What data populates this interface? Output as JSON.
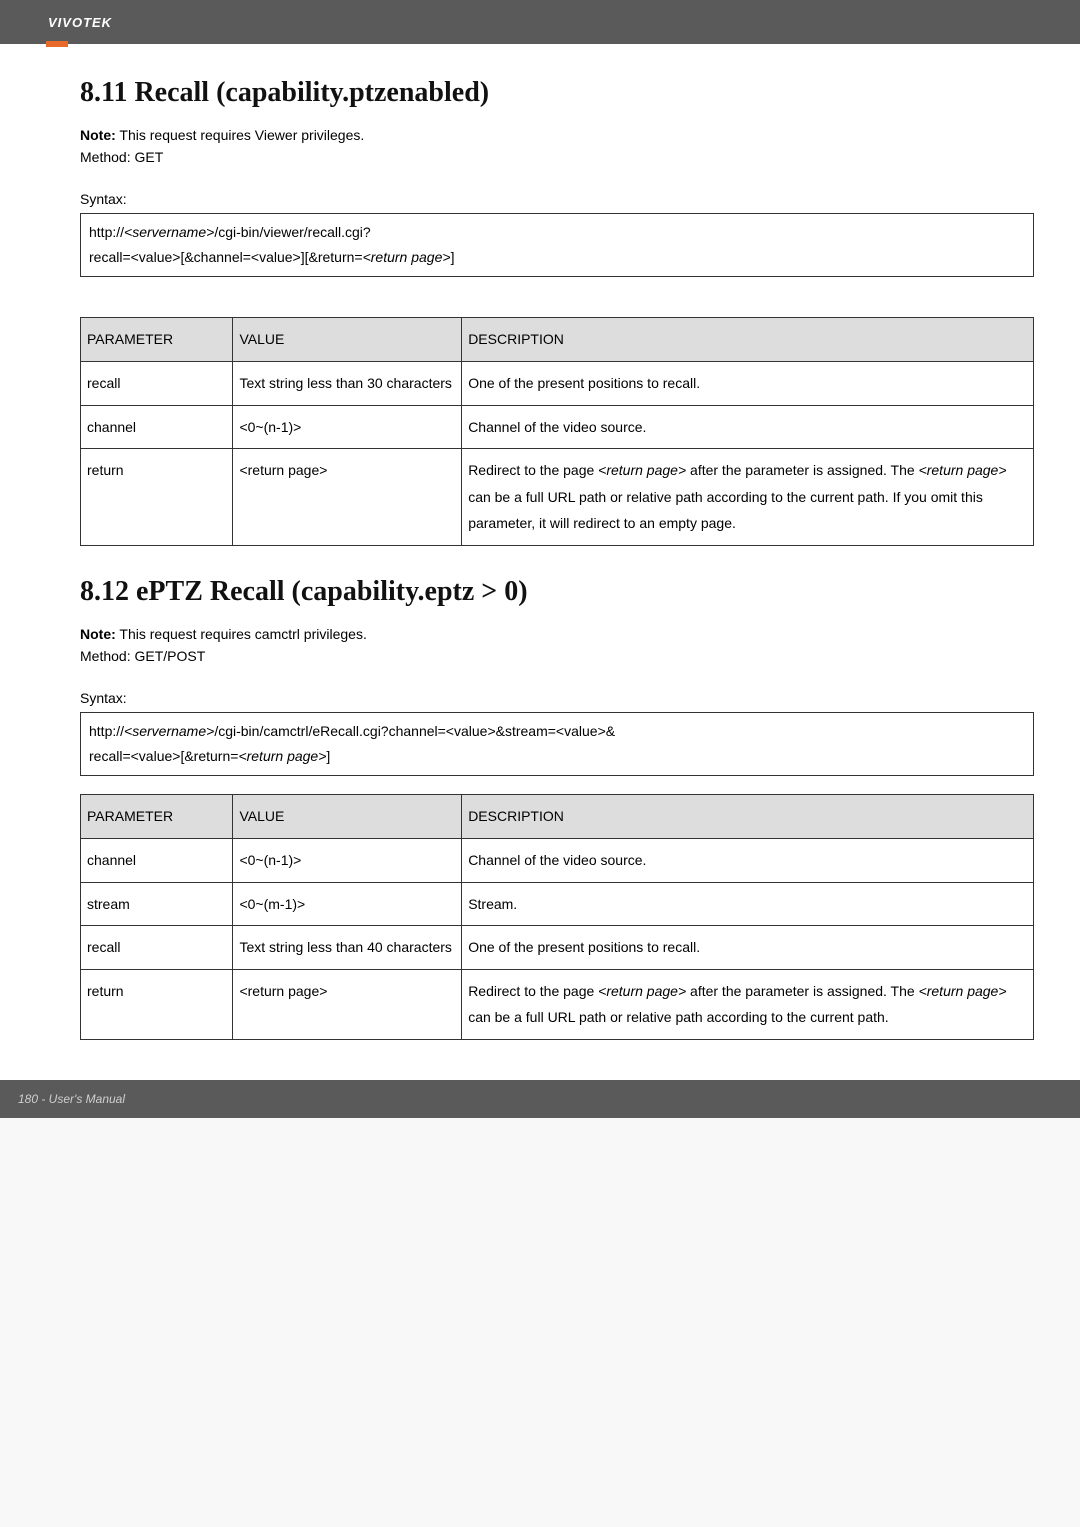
{
  "header": {
    "brand": "VIVOTEK"
  },
  "section1": {
    "title": "8.11 Recall (capability.ptzenabled)",
    "note_bold": "Note:",
    "note_text": " This request requires Viewer privileges.",
    "method": "Method: GET",
    "syntax_label": "Syntax:",
    "syntax_line1_pre": "http://",
    "syntax_line1_srv": "<servername>",
    "syntax_line1_post": "/cgi-bin/viewer/recall.cgi?",
    "syntax_line2_pre": "recall=<value>[&channel=<value>][&return=",
    "syntax_line2_rp": "<return page>",
    "syntax_line2_post": "]",
    "headers": {
      "param": "PARAMETER",
      "value": "VALUE",
      "desc": "DESCRIPTION"
    },
    "rows": {
      "r0": {
        "param": "recall",
        "value": "Text string less than 30 characters",
        "desc": "One of the present positions to recall."
      },
      "r1": {
        "param": "channel",
        "value": "<0~(n-1)>",
        "desc": "Channel of the video source."
      },
      "r2": {
        "param": "return",
        "value": "<return page>",
        "d_pre1": "Redirect to the page ",
        "d_rp1": "<return page>",
        "d_post1": " after the parameter is assigned. The ",
        "d_rp2": "<return page>",
        "d_post2": " can be a full URL path or relative path according to the current path. If you omit this parameter, it will redirect to an empty page."
      }
    }
  },
  "section2": {
    "title": "8.12 ePTZ Recall (capability.eptz > 0)",
    "note_bold": "Note:",
    "note_text": " This request requires camctrl privileges.",
    "method": "Method: GET/POST",
    "syntax_label": "Syntax:",
    "syntax_line1_pre": "http://",
    "syntax_line1_srv": "<servername>",
    "syntax_line1_post": "/cgi-bin/camctrl/eRecall.cgi?channel=<value>&stream=<value>&",
    "syntax_line2_pre": "recall=<value>[&return=",
    "syntax_line2_rp": "<return page>",
    "syntax_line2_post": "]",
    "headers": {
      "param": "PARAMETER",
      "value": "VALUE",
      "desc": "DESCRIPTION"
    },
    "rows": {
      "r0": {
        "param": "channel",
        "value": "<0~(n-1)>",
        "desc": "Channel of the video source."
      },
      "r1": {
        "param": "stream",
        "value": "<0~(m-1)>",
        "desc": "Stream."
      },
      "r2": {
        "param": "recall",
        "value": "Text string less than 40 characters",
        "desc": "One of the present positions to recall."
      },
      "r3": {
        "param": "return",
        "value": "<return page>",
        "d_pre1": "Redirect to the page ",
        "d_rp1": "<return page>",
        "d_post1": " after the parameter is assigned. The ",
        "d_rp2": "<return page>",
        "d_post2": " can be a full URL path or relative path according to the current path."
      }
    }
  },
  "footer": {
    "text": "180 - User's Manual"
  }
}
